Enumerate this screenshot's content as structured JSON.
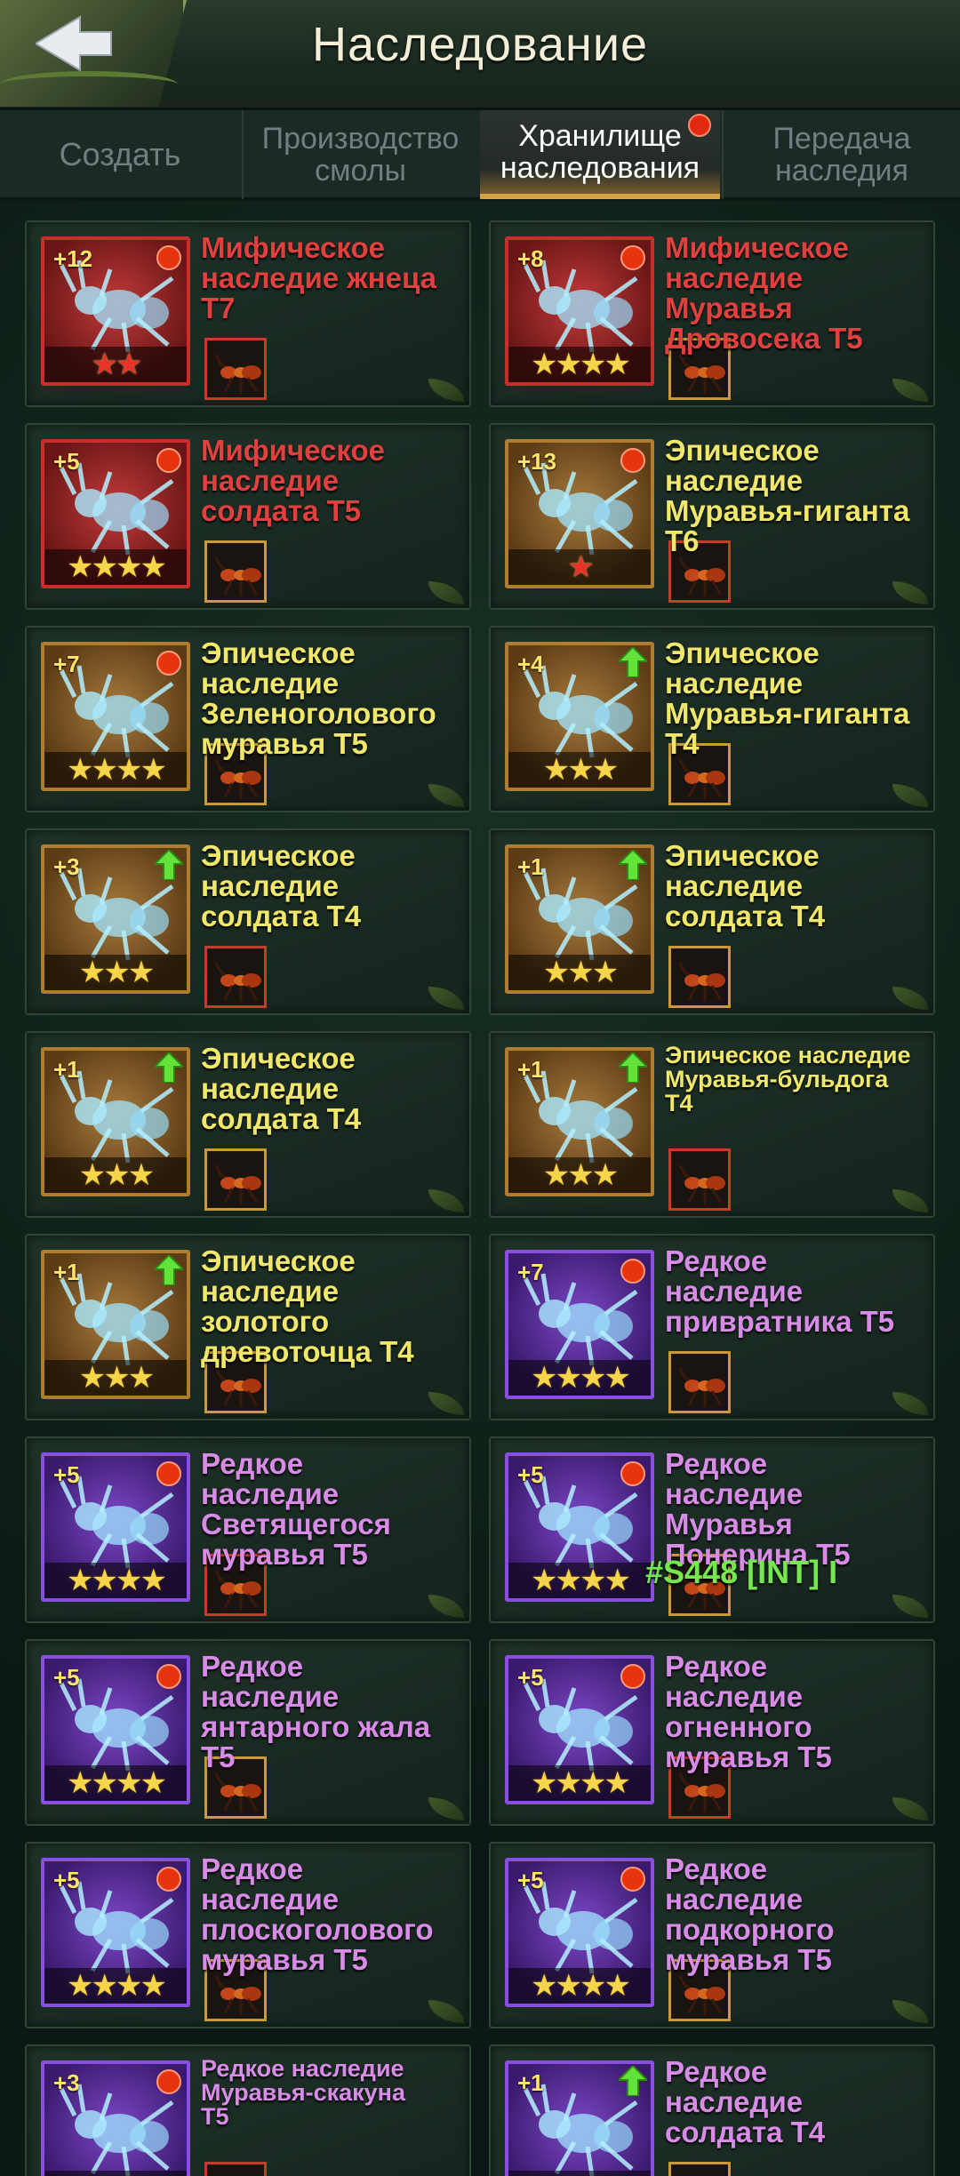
{
  "header": {
    "title": "Наследование",
    "back_icon": "back-arrow-icon"
  },
  "tabs": [
    {
      "label": "Создать",
      "active": false,
      "badge": false
    },
    {
      "label": "Производство\nсмолы",
      "active": false,
      "badge": false
    },
    {
      "label": "Хранилище\nнаследования",
      "active": true,
      "badge": true
    },
    {
      "label": "Передача\nнаследия",
      "active": false,
      "badge": false
    }
  ],
  "colors": {
    "mythic": "#e23f3f",
    "epic": "#f0e76b",
    "rare": "#d98be8",
    "active_tab_accent": "#d7a442",
    "star_gold": "#f7d54a",
    "star_red": "#e8322a"
  },
  "cards": [
    {
      "level": "+12",
      "name": "Мифическое\nнаследие жнеца\nТ7",
      "rarity": "mythic",
      "stars": "★★",
      "star_color": "red",
      "indicator": "dot"
    },
    {
      "level": "+8",
      "name": "Мифическое\nнаследие\nМуравья\nДровосека Т5",
      "rarity": "mythic",
      "stars": "★★★★",
      "star_color": "gold",
      "indicator": "dot"
    },
    {
      "level": "+5",
      "name": "Мифическое\nнаследие\nсолдата Т5",
      "rarity": "mythic",
      "stars": "★★★★",
      "star_color": "gold",
      "indicator": "dot"
    },
    {
      "level": "+13",
      "name": "Эпическое\nнаследие\nМуравья-гиганта\nТ6",
      "rarity": "epic",
      "stars": "★",
      "star_color": "red",
      "indicator": "dot"
    },
    {
      "level": "+7",
      "name": "Эпическое\nнаследие\nЗеленоголового\nмуравья Т5",
      "rarity": "epic",
      "stars": "★★★★",
      "star_color": "gold",
      "indicator": "dot"
    },
    {
      "level": "+4",
      "name": "Эпическое\nнаследие\nМуравья-гиганта\nТ4",
      "rarity": "epic",
      "stars": "★★★",
      "star_color": "gold",
      "indicator": "arrow"
    },
    {
      "level": "+3",
      "name": "Эпическое\nнаследие\nсолдата Т4",
      "rarity": "epic",
      "stars": "★★★",
      "star_color": "gold",
      "indicator": "arrow"
    },
    {
      "level": "+1",
      "name": "Эпическое\nнаследие\nсолдата Т4",
      "rarity": "epic",
      "stars": "★★★",
      "star_color": "gold",
      "indicator": "arrow"
    },
    {
      "level": "+1",
      "name": "Эпическое\nнаследие\nсолдата Т4",
      "rarity": "epic",
      "stars": "★★★",
      "star_color": "gold",
      "indicator": "arrow"
    },
    {
      "level": "+1",
      "name": "Эпическое наследие\nМуравья-бульдога\nТ4",
      "rarity": "epic",
      "stars": "★★★",
      "star_color": "gold",
      "indicator": "arrow",
      "small": true
    },
    {
      "level": "+1",
      "name": "Эпическое\nнаследие\nзолотого\nдревоточца Т4",
      "rarity": "epic",
      "stars": "★★★",
      "star_color": "gold",
      "indicator": "arrow"
    },
    {
      "level": "+7",
      "name": "Редкое\nнаследие\nпривратника Т5",
      "rarity": "rare",
      "stars": "★★★★",
      "star_color": "gold",
      "indicator": "dot"
    },
    {
      "level": "+5",
      "name": "Редкое\nнаследие\nСветящегося\nмуравья Т5",
      "rarity": "rare",
      "stars": "★★★★",
      "star_color": "gold",
      "indicator": "dot"
    },
    {
      "level": "+5",
      "name": "Редкое\nнаследие\nМуравья\nПонерина Т5",
      "rarity": "rare",
      "stars": "★★★★",
      "star_color": "gold",
      "indicator": "dot"
    },
    {
      "level": "+5",
      "name": "Редкое\nнаследие\nянтарного жала\nТ5",
      "rarity": "rare",
      "stars": "★★★★",
      "star_color": "gold",
      "indicator": "dot"
    },
    {
      "level": "+5",
      "name": "Редкое\nнаследие\nогненного\nмуравья Т5",
      "rarity": "rare",
      "stars": "★★★★",
      "star_color": "gold",
      "indicator": "dot"
    },
    {
      "level": "+5",
      "name": "Редкое\nнаследие\nплоскоголового\nмуравья Т5",
      "rarity": "rare",
      "stars": "★★★★",
      "star_color": "gold",
      "indicator": "dot"
    },
    {
      "level": "+5",
      "name": "Редкое\nнаследие\nподкорного\nмуравья Т5",
      "rarity": "rare",
      "stars": "★★★★",
      "star_color": "gold",
      "indicator": "dot"
    },
    {
      "level": "+3",
      "name": "Редкое наследие\nМуравья-скакуна\nТ5",
      "rarity": "rare",
      "stars": "★★★★",
      "star_color": "gold",
      "indicator": "dot",
      "small": true
    },
    {
      "level": "+1",
      "name": "Редкое\nнаследие\nсолдата Т4",
      "rarity": "rare",
      "stars": "★★★",
      "star_color": "gold",
      "indicator": "arrow"
    }
  ],
  "chat_overlay": "#S448 [INT] I"
}
